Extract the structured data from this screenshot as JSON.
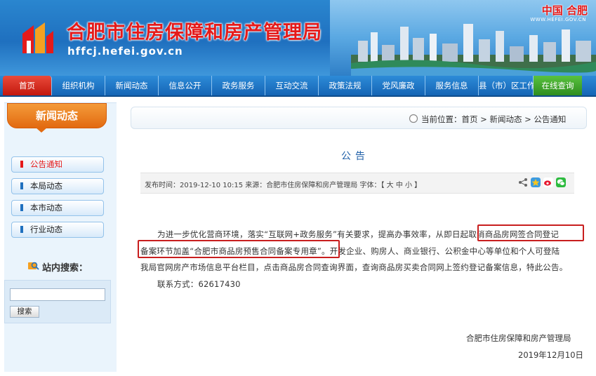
{
  "header": {
    "title": "合肥市住房保障和房产管理局",
    "url": "hffcj.hefei.gov.cn",
    "brand": "中国 合肥",
    "brand_url": "WWW.HEFEI.GOV.CN"
  },
  "nav": [
    {
      "label": "首页"
    },
    {
      "label": "组织机构"
    },
    {
      "label": "新闻动态"
    },
    {
      "label": "信息公开"
    },
    {
      "label": "政务服务"
    },
    {
      "label": "互动交流"
    },
    {
      "label": "政策法规"
    },
    {
      "label": "党风廉政"
    },
    {
      "label": "服务信息"
    },
    {
      "label": "县（市）区工作"
    },
    {
      "label": "在线查询"
    }
  ],
  "sidebar": {
    "title": "新闻动态",
    "items": [
      {
        "label": "公告通知"
      },
      {
        "label": "本局动态"
      },
      {
        "label": "本市动态"
      },
      {
        "label": "行业动态"
      }
    ],
    "search_title": "站内搜索：",
    "search_button": "搜索"
  },
  "breadcrumb": {
    "prefix": "当前位置：",
    "home": "首页",
    "sep1": " > ",
    "section": "新闻动态",
    "sep2": " > ",
    "current": "公告通知"
  },
  "article": {
    "title": "公告",
    "meta": "发布时间：2019-12-10 10:15  来源：合肥市住房保障和房产管理局   字体：【 大 中 小 】",
    "lines": [
      "为进一步优化营商环境，落实“互联网+政务服务”有关要求，提高办事效率，从即日起取消商品房网签合同登记",
      "备案环节加盖“合肥市商品房预售合同备案专用章”。开发企业、购房人、商业银行、公积金中心等单位和个人可登陆",
      "我局官网房产市场信息平台栏目，点击商品房合同查询界面，查询商品房买卖合同网上签约登记备案信息，特此公告。"
    ],
    "contact": "联系方式：62617430",
    "signature": "合肥市住房保障和房产管理局",
    "date": "2019年12月10日"
  },
  "colors": {
    "header_blue": "#1f70bf",
    "title_red": "#e51a1a",
    "highlight_red": "#c81e1e",
    "sidebar_orange": "#e26a10"
  }
}
